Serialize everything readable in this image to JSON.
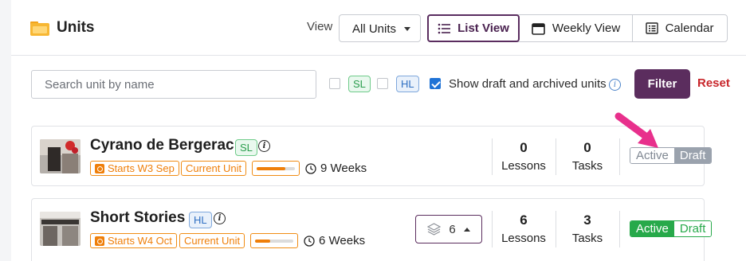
{
  "header": {
    "title": "Units",
    "view_label": "View",
    "select_value": "All Units",
    "views": [
      {
        "label": "List View",
        "icon": "list-icon",
        "active": true
      },
      {
        "label": "Weekly View",
        "icon": "calendar-week-icon",
        "active": false
      },
      {
        "label": "Calendar",
        "icon": "calendar-grid-icon",
        "active": false
      }
    ]
  },
  "filters": {
    "search_placeholder": "Search unit by name",
    "sl_label": "SL",
    "hl_label": "HL",
    "show_draft_label": "Show draft and archived units",
    "show_draft_checked": true,
    "filter_label": "Filter",
    "reset_label": "Reset",
    "info_glyph": "i"
  },
  "units": [
    {
      "title": "Cyrano de Bergerac",
      "level": "SL",
      "start": "Starts W3 Sep",
      "current": "Current Unit",
      "progress": 0.75,
      "weeks": "9 Weeks",
      "lessons_num": "0",
      "lessons_label": "Lessons",
      "tasks_num": "0",
      "tasks_label": "Tasks",
      "status_active": "Active",
      "status_draft": "Draft",
      "status": "draft"
    },
    {
      "title": "Short Stories",
      "level": "HL",
      "start": "Starts W4 Oct",
      "current": "Current Unit",
      "progress": 0.4,
      "weeks": "6 Weeks",
      "layers_count": "6",
      "lessons_num": "6",
      "lessons_label": "Lessons",
      "tasks_num": "3",
      "tasks_label": "Tasks",
      "status_active": "Active",
      "status_draft": "Draft",
      "status": "active"
    }
  ],
  "colors": {
    "brand": "#5b2d5e",
    "accent_orange": "#ef7f0a",
    "active_green": "#27a94a",
    "reset_red": "#c8262b",
    "arrow_pink": "#e8308c"
  }
}
